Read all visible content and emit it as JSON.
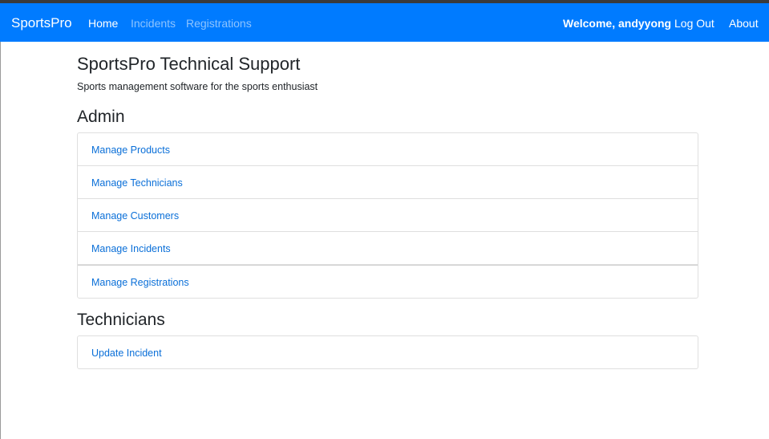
{
  "navbar": {
    "brand": "SportsPro",
    "links": [
      {
        "label": "Home"
      },
      {
        "label": "Incidents"
      },
      {
        "label": "Registrations"
      }
    ],
    "welcome": "Welcome, andyyong",
    "logout": "Log Out",
    "about": "About"
  },
  "colors": {
    "navbar_bg": "#007bff",
    "link": "#0a6fd8",
    "text": "#212529"
  },
  "main": {
    "title": "SportsPro Technical Support",
    "subtitle": "Sports management software for the sports enthusiast",
    "admin": {
      "heading": "Admin",
      "items": [
        {
          "label": "Manage Products"
        },
        {
          "label": "Manage Technicians"
        },
        {
          "label": "Manage Customers"
        },
        {
          "label": "Manage Incidents"
        },
        {
          "label": "Manage Registrations"
        }
      ]
    },
    "technicians": {
      "heading": "Technicians",
      "items": [
        {
          "label": "Update Incident"
        }
      ]
    }
  }
}
